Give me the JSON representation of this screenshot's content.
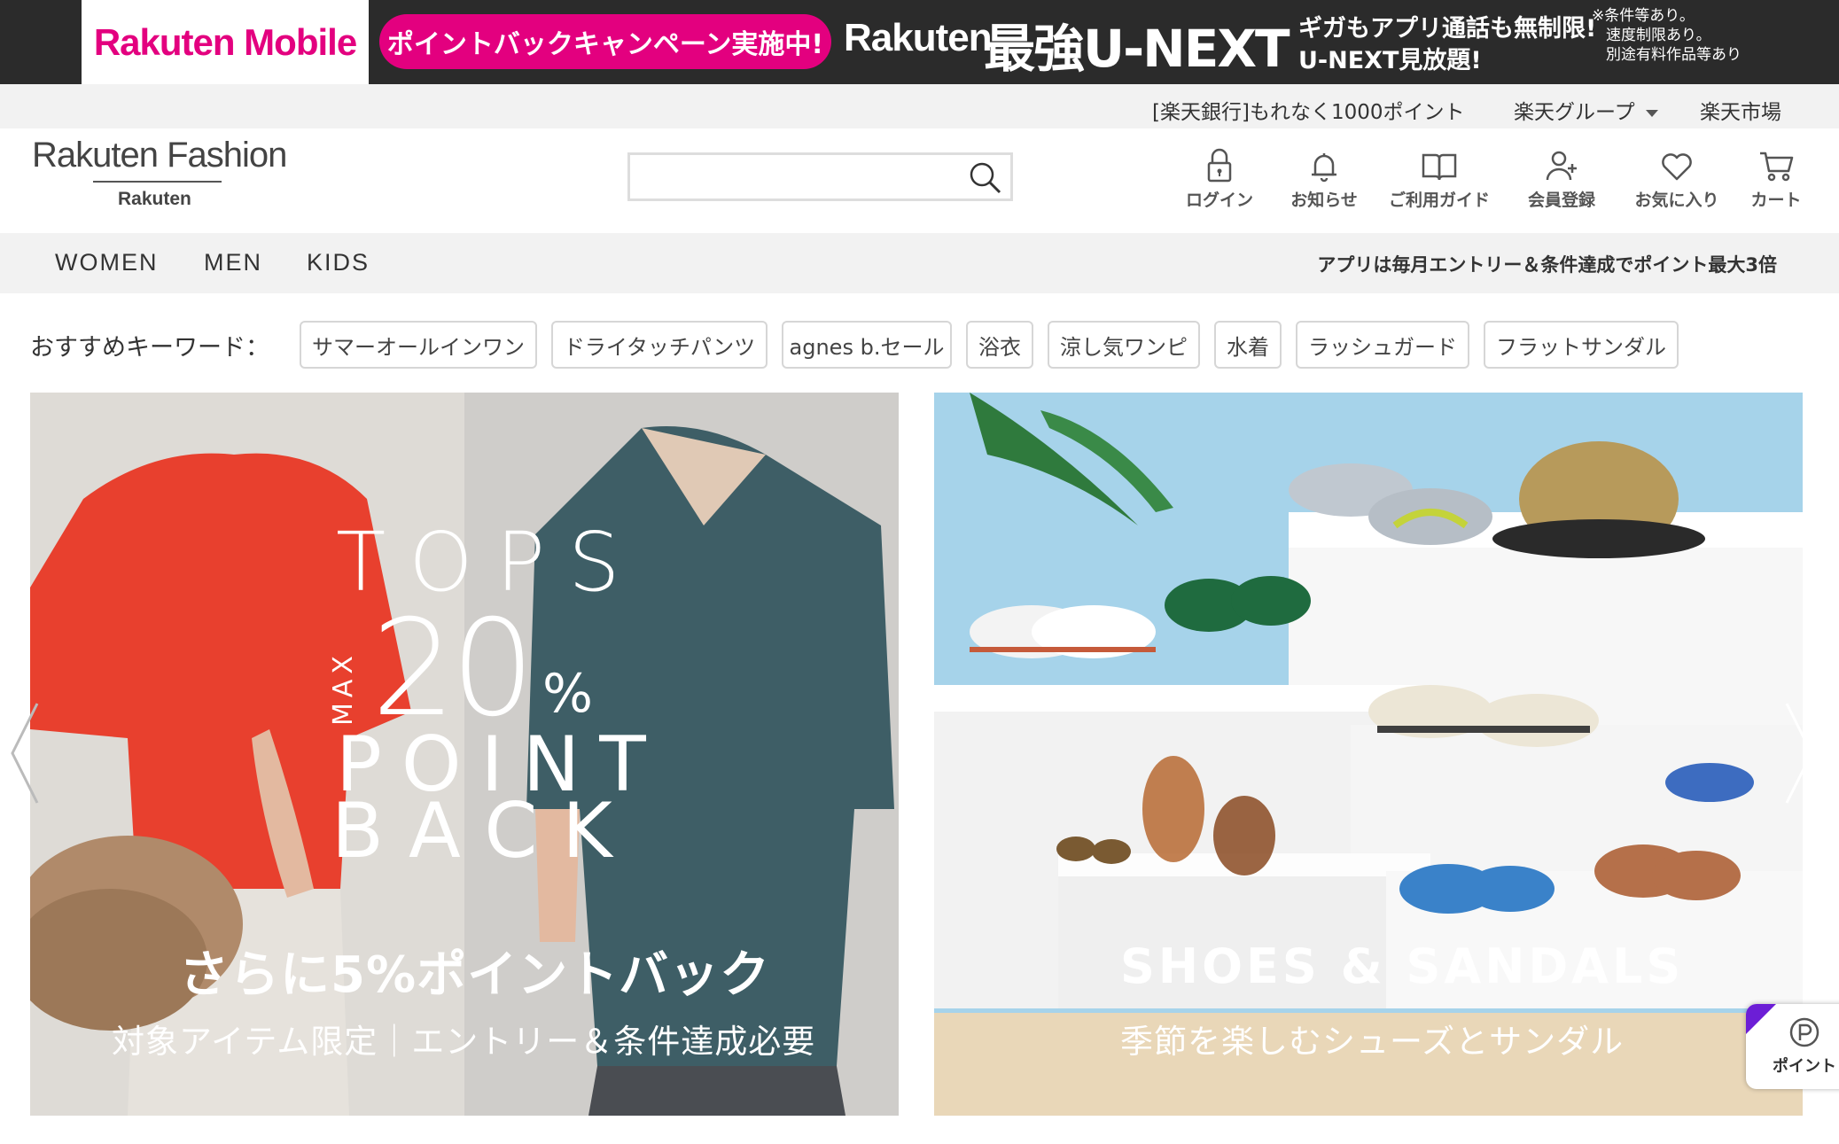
{
  "promo": {
    "logo": "Rakuten Mobile",
    "pill": "ポイントバックキャンペーン実施中!",
    "brand": "Rakuten",
    "title": "最強U-NEXT",
    "sub1": "ギガもアプリ通話も無制限!",
    "sub2": "U-NEXT見放題!",
    "notes": [
      "※条件等あり。",
      "速度制限あり。",
      "別途有料作品等あり"
    ]
  },
  "utility": {
    "bank_link": "[楽天銀行]もれなく1000ポイント",
    "group_link": "楽天グループ",
    "market_link": "楽天市場"
  },
  "header": {
    "logo_main": "Rakuten Fashion",
    "logo_sub": "Rakuten",
    "search": {
      "value": "",
      "placeholder": ""
    },
    "nav": [
      {
        "label": "ログイン",
        "icon": "lock-icon"
      },
      {
        "label": "お知らせ",
        "icon": "bell-icon"
      },
      {
        "label": "ご利用ガイド",
        "icon": "book-icon"
      },
      {
        "label": "会員登録",
        "icon": "user-add-icon"
      },
      {
        "label": "お気に入り",
        "icon": "heart-icon"
      },
      {
        "label": "カート",
        "icon": "cart-icon"
      }
    ]
  },
  "categories": {
    "items": [
      "WOMEN",
      "MEN",
      "KIDS"
    ],
    "note": "アプリは毎月エントリー＆条件達成でポイント最大3倍"
  },
  "keywords": {
    "label": "おすすめキーワード：",
    "items": [
      "サマーオールインワン",
      "ドライタッチパンツ",
      "agnes b.セール",
      "浴衣",
      "涼し気ワンピ",
      "水着",
      "ラッシュガード",
      "フラットサンダル"
    ]
  },
  "banners": [
    {
      "line1": "TOPS",
      "max": "MAX",
      "percent": "20",
      "percent_sign": "%",
      "line3": "POINT",
      "line4": "BACK",
      "headline": "さらに5%ポイントバック",
      "caption": "対象アイテム限定｜エントリー＆条件達成必要"
    },
    {
      "headline": "SHOES & SANDALS",
      "caption": "季節を楽しむシューズとサンダル"
    }
  ],
  "point_widget": {
    "label": "ポイント"
  },
  "colors": {
    "brand_pink": "#e3007f",
    "bar_gray": "#f2f2f2",
    "widget_purple": "#6c1ed6"
  }
}
